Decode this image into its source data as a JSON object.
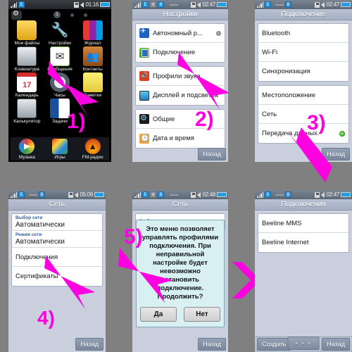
{
  "meta": {
    "accent_magenta": "#ff00e0",
    "background": "#808080",
    "title_bar_color": "#aeb8ca"
  },
  "panels": [
    {
      "id": "home",
      "step": "1)",
      "status": {
        "clock": "01:16"
      },
      "page_indicator": "1",
      "apps": [
        {
          "label": "Мои файлы",
          "icon": "folder-icon"
        },
        {
          "label": "Настройки",
          "icon": "tools-icon"
        },
        {
          "label": "Журнал",
          "icon": "call-log-icon"
        },
        {
          "label": "Клавиатура",
          "icon": "dialpad-icon"
        },
        {
          "label": "Сообщения",
          "icon": "envelope-icon"
        },
        {
          "label": "Контакты",
          "icon": "contacts-icon"
        },
        {
          "label": "Календарь",
          "icon": "calendar-icon"
        },
        {
          "label": "Часы",
          "icon": "clock-icon"
        },
        {
          "label": "Заметки",
          "icon": "notes-icon"
        },
        {
          "label": "Калькулятор",
          "icon": "calculator-icon"
        },
        {
          "label": "Задачи",
          "icon": "tasks-icon"
        }
      ],
      "dock": [
        {
          "label": "Музыка",
          "icon": "music-icon"
        },
        {
          "label": "Игры",
          "icon": "games-icon"
        },
        {
          "label": "FM-радио",
          "icon": "radio-icon"
        }
      ]
    },
    {
      "id": "settings",
      "step": "2)",
      "title": "Настройки",
      "status": {
        "clock": "02:47"
      },
      "softkey_right": "Назад",
      "groups": [
        {
          "rows": [
            {
              "label": "Автономный р...",
              "icon": "airplane-icon",
              "indicator": "toggle-off"
            },
            {
              "label": "Подключение",
              "icon": "connection-icon"
            }
          ]
        },
        {
          "rows": [
            {
              "label": "Профили звука",
              "icon": "sound-icon"
            },
            {
              "label": "Дисплей и подсветка",
              "icon": "display-icon"
            }
          ]
        },
        {
          "rows": [
            {
              "label": "Общие",
              "icon": "general-icon"
            },
            {
              "label": "Дата и время",
              "icon": "datetime-icon"
            }
          ]
        }
      ]
    },
    {
      "id": "connection",
      "step": "3)",
      "title": "Подключение",
      "status": {
        "clock": "02:47"
      },
      "softkey_right": "Назад",
      "groups": [
        {
          "rows": [
            {
              "label": "Bluetooth"
            },
            {
              "label": "Wi-Fi"
            },
            {
              "label": "Синхронизация"
            }
          ]
        },
        {
          "rows": [
            {
              "label": "Местоположение"
            },
            {
              "label": "Сеть"
            },
            {
              "label": "Передача данных.",
              "indicator": "status-green"
            }
          ]
        }
      ]
    },
    {
      "id": "network",
      "step": "4)",
      "title": "Сеть",
      "status": {
        "clock": "05:09"
      },
      "softkey_right": "Назад",
      "groups": [
        {
          "rows": [
            {
              "sublabel": "Выбор сети",
              "value": "Автоматически"
            },
            {
              "sublabel": "Режим сети",
              "value": "Автоматически"
            },
            {
              "label": "Подключения"
            },
            {
              "label": "Сертификаты"
            }
          ]
        }
      ]
    },
    {
      "id": "network-dialog",
      "step": "5)",
      "title": "Сеть",
      "status": {
        "clock": "02:48"
      },
      "softkey_right": "Назад",
      "behind_row_label": "Выбор сети",
      "dialog": {
        "message": "Это меню позволяет управлять профилями подключения. При неправильной настройке будет невозможно установить подключение. Продолжить?",
        "confirm": "Да",
        "cancel": "Нет"
      }
    },
    {
      "id": "connections-list",
      "title": "Подключения",
      "status": {
        "clock": "02:47"
      },
      "softkey_left": "Создать",
      "softkey_mid": "• • •",
      "softkey_right": "Назад",
      "groups": [
        {
          "rows": [
            {
              "label": "Beeline MMS"
            },
            {
              "label": "Beeline Internet"
            }
          ]
        }
      ]
    }
  ]
}
